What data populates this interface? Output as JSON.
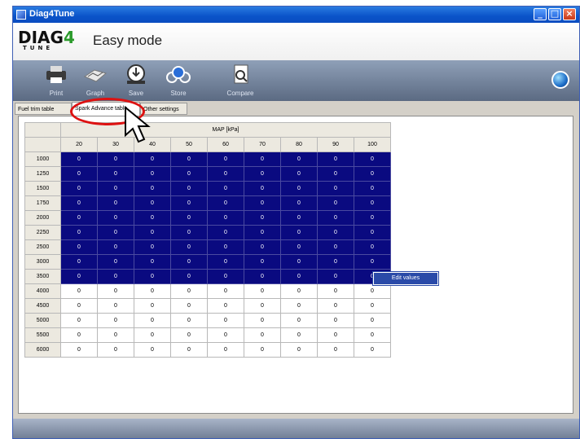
{
  "window": {
    "title": "Diag4Tune"
  },
  "brand": {
    "logo_main": "DIAG",
    "logo_four": "4",
    "logo_sub": "TUNE",
    "mode": "Easy mode"
  },
  "toolbar": {
    "buttons": [
      {
        "label": "Print",
        "icon": "printer-icon"
      },
      {
        "label": "Graph",
        "icon": "graph-icon"
      },
      {
        "label": "Save",
        "icon": "save-icon"
      },
      {
        "label": "Store",
        "icon": "store-icon"
      },
      {
        "label": "Compare",
        "icon": "compare-icon"
      }
    ]
  },
  "tabs": [
    "Fuel trim table",
    "Spark Advance table",
    "Other settings"
  ],
  "active_tab": "Spark Advance table",
  "table": {
    "group_header": "MAP [kPa]",
    "columns": [
      "20",
      "30",
      "40",
      "50",
      "60",
      "70",
      "80",
      "90",
      "100"
    ],
    "rows": [
      "1000",
      "1250",
      "1500",
      "1750",
      "2000",
      "2250",
      "2500",
      "3000",
      "3500",
      "4000",
      "4500",
      "5000",
      "5500",
      "6000"
    ],
    "cell_value": "0",
    "selected_rows": 9
  },
  "context_menu": {
    "item": "Edit values"
  },
  "colors": {
    "selection": "#0a0a80",
    "annotation": "#d11111",
    "titlebar": "#0a53c9"
  }
}
